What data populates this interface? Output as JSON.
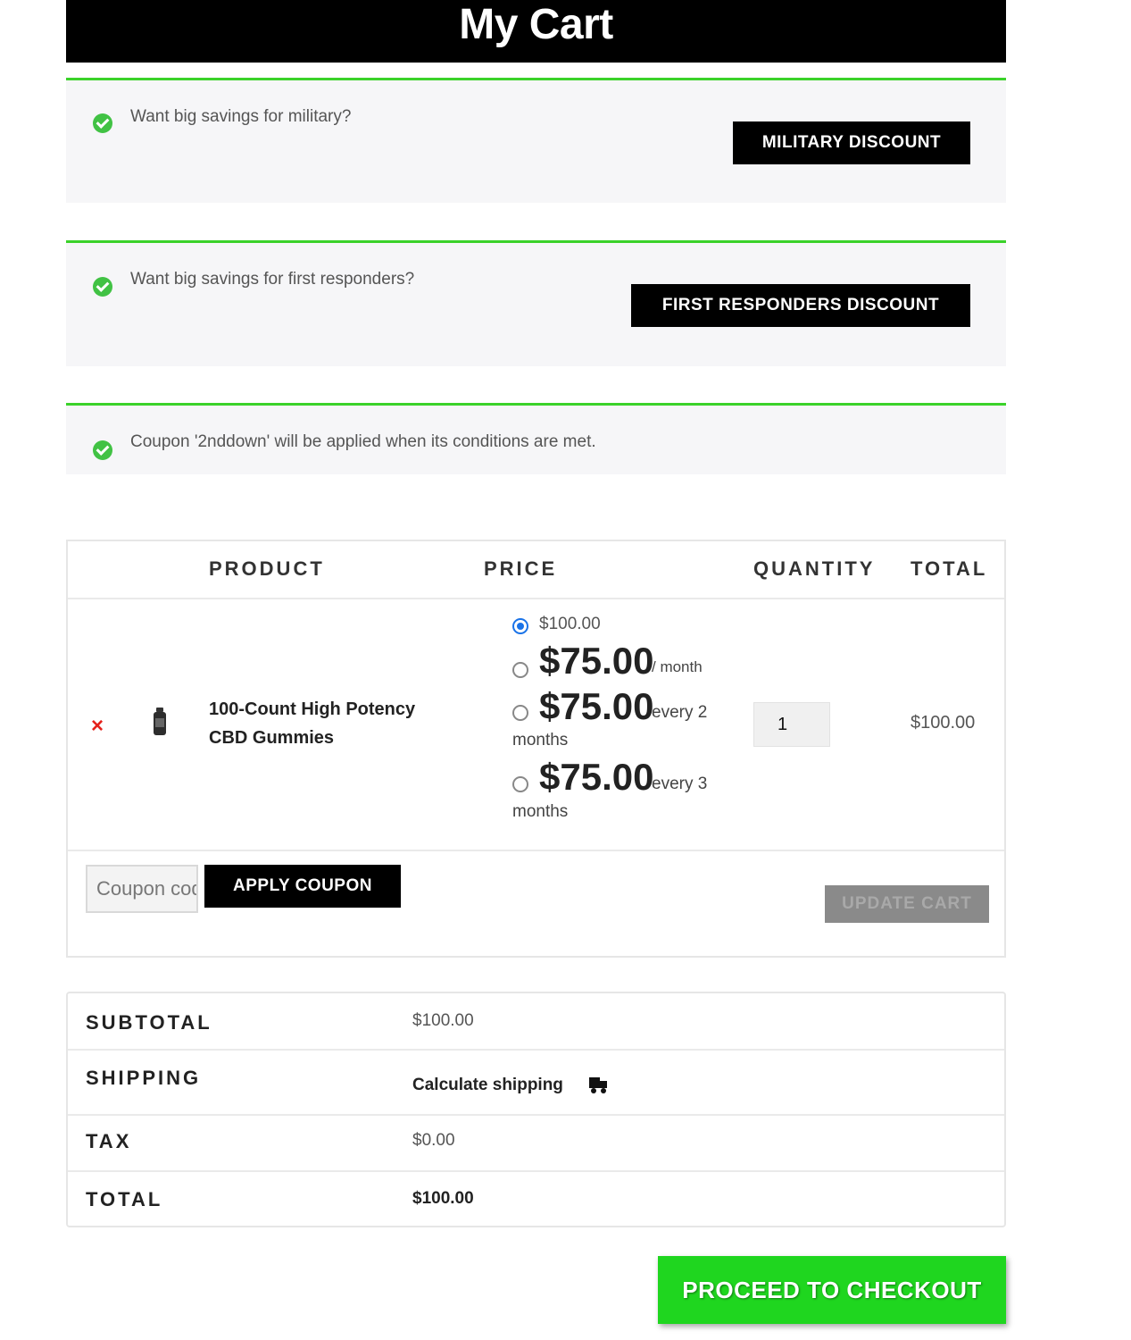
{
  "header": {
    "title": "My Cart"
  },
  "notices": {
    "military": {
      "message": "Want big savings for military?",
      "button": "MILITARY DISCOUNT"
    },
    "first_responders": {
      "message": "Want big savings for first responders?",
      "button": "FIRST RESPONDERS DISCOUNT"
    },
    "coupon": {
      "message": "Coupon '2nddown' will be applied when its conditions are met."
    }
  },
  "table": {
    "headers": {
      "product": "PRODUCT",
      "price": "PRICE",
      "quantity": "QUANTITY",
      "total": "TOTAL"
    },
    "item": {
      "remove": "×",
      "name": "100-Count High Potency CBD Gummies",
      "price_options": [
        {
          "price": "$100.00",
          "selected": true
        },
        {
          "price": "$75.00",
          "period": "/ month"
        },
        {
          "price": "$75.00",
          "period_line1": "every 2",
          "period_line2": "months"
        },
        {
          "price": "$75.00",
          "period_line1": "every 3",
          "period_line2": "months"
        }
      ],
      "quantity": "1",
      "total": "$100.00"
    },
    "coupon_placeholder": "Coupon code",
    "apply_coupon": "APPLY COUPON",
    "update_cart": "UPDATE CART"
  },
  "totals": {
    "subtotal_label": "SUBTOTAL",
    "subtotal": "$100.00",
    "shipping_label": "SHIPPING",
    "shipping": "Calculate shipping",
    "tax_label": "TAX",
    "tax": "$0.00",
    "total_label": "TOTAL",
    "total": "$100.00"
  },
  "checkout_button": "PROCEED TO CHECKOUT",
  "colors": {
    "accent_green": "#3bd22a",
    "checkout_green": "#1fd61f",
    "remove_red": "#e5211b"
  }
}
